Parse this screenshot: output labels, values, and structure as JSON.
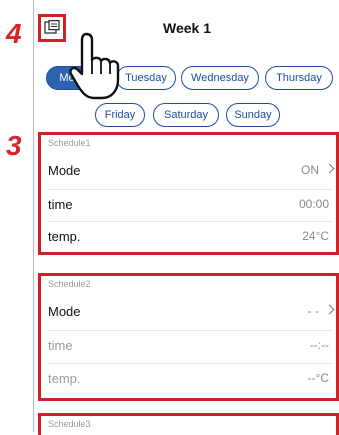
{
  "steps": {
    "step_4": "4",
    "step_3": "3"
  },
  "header": {
    "title": "Week 1",
    "icon": "schedule-copy-icon"
  },
  "days": [
    {
      "label": "Monday",
      "selected": true
    },
    {
      "label": "Tuesday",
      "selected": false
    },
    {
      "label": "Wednesday",
      "selected": false
    },
    {
      "label": "Thursday",
      "selected": false
    },
    {
      "label": "Friday",
      "selected": false
    },
    {
      "label": "Saturday",
      "selected": false
    },
    {
      "label": "Sunday",
      "selected": false
    }
  ],
  "schedules": [
    {
      "caption": "Schedule1",
      "mode_label": "Mode",
      "mode_value": "ON",
      "time_label": "time",
      "time_value": "00:00",
      "temp_label": "temp.",
      "temp_value": "24°C"
    },
    {
      "caption": "Schedule2",
      "mode_label": "Mode",
      "mode_value": "- -",
      "time_label": "time",
      "time_value": "--:--",
      "temp_label": "temp.",
      "temp_value": "--°C"
    },
    {
      "caption": "Schedule3"
    }
  ],
  "colors": {
    "accent": "#2f63b2",
    "highlight": "#d0202a",
    "step": "#d8232a"
  }
}
